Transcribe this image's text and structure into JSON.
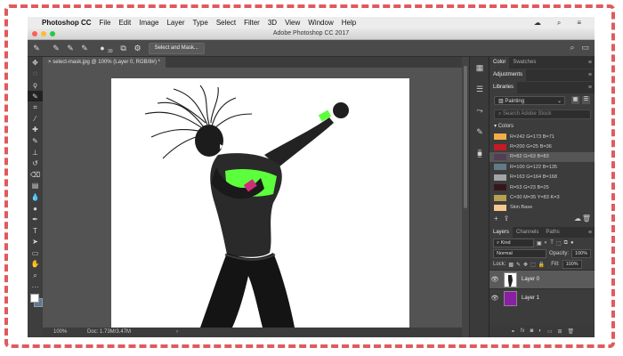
{
  "menubar": {
    "apple": "",
    "app": "Photoshop CC",
    "items": [
      "File",
      "Edit",
      "Image",
      "Layer",
      "Type",
      "Select",
      "Filter",
      "3D",
      "View",
      "Window",
      "Help"
    ]
  },
  "window": {
    "title": "Adobe Photoshop CC 2017"
  },
  "options": {
    "brush_size": "30",
    "select_mask_label": "Select and Mask..."
  },
  "document": {
    "tab_label": "select-mask.jpg @ 100% (Layer 0, RGB/8#) *"
  },
  "status": {
    "zoom": "100%",
    "doc_info": "Doc: 1.73M/3.47M"
  },
  "panels": {
    "top_tabs": [
      "Color",
      "Swatches"
    ],
    "adjustments_tab": "Adjustments",
    "libraries_tab": "Libraries",
    "library_select": "Painting",
    "search_placeholder": "Search Adobe Stock",
    "colors_heading": "Colors",
    "colors": [
      {
        "label": "R=242 G=173 B=71",
        "hex": "#f2ad47"
      },
      {
        "label": "R=200 G=25 B=36",
        "hex": "#c81924"
      },
      {
        "label": "R=82 G=63 B=83",
        "hex": "#523f53"
      },
      {
        "label": "R=100 G=122 B=135",
        "hex": "#647a87"
      },
      {
        "label": "R=163 G=164 B=168",
        "hex": "#a3a4a8"
      },
      {
        "label": "R=53 G=23 B=25",
        "hex": "#351719"
      },
      {
        "label": "C=30 M=35 Y=83 K=3",
        "hex": "#b7a051"
      },
      {
        "label": "Skin Base",
        "hex": "#f5c98f"
      }
    ],
    "layers_tabs": [
      "Layers",
      "Channels",
      "Paths"
    ],
    "kind_label": "Kind",
    "blend_mode": "Normal",
    "opacity_label": "Opacity:",
    "opacity_value": "100%",
    "lock_label": "Lock:",
    "fill_label": "Fill:",
    "fill_value": "100%",
    "layers": [
      "Layer 0",
      "Layer 1"
    ]
  },
  "colors": {
    "accent_green": "#5cff3c",
    "accent_pink": "#d02c7a",
    "layer1_purple": "#8b1fa3"
  }
}
